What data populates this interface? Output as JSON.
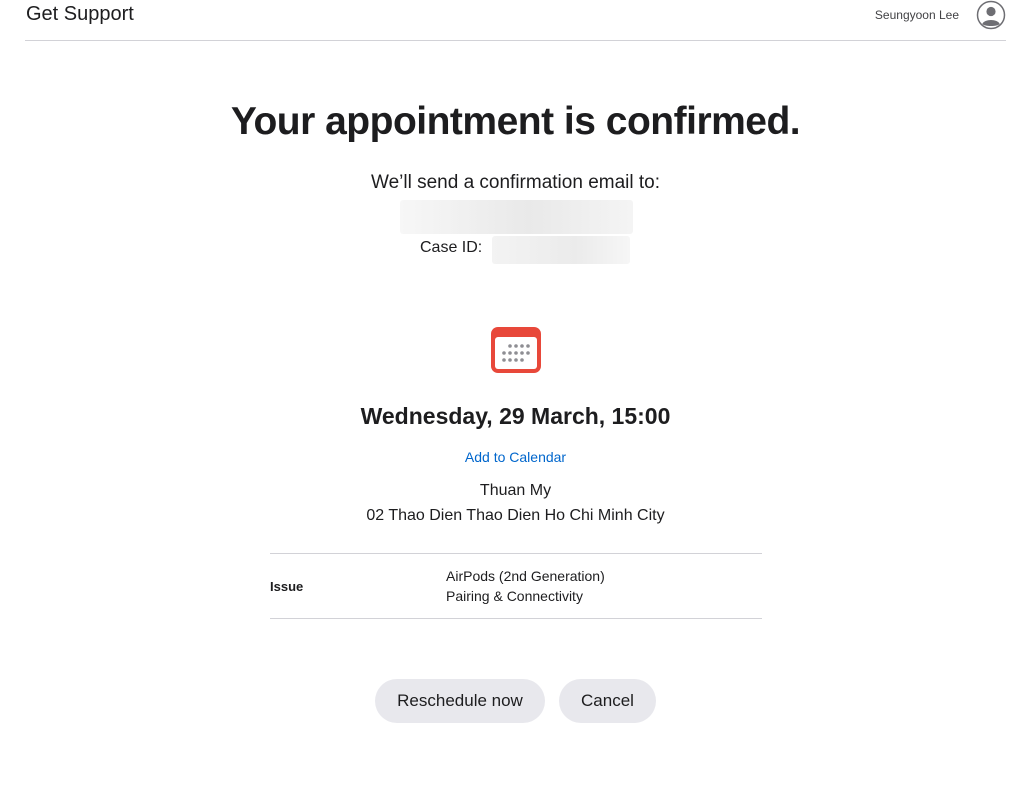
{
  "header": {
    "title": "Get Support",
    "user_name": "Seungyoon Lee",
    "avatar_icon": "user-circle-icon"
  },
  "confirmation": {
    "title": "Your appointment is confirmed.",
    "email_text": "We’ll send a confirmation email to:",
    "case_id_label": "Case ID:"
  },
  "appointment": {
    "calendar_icon": "calendar-icon",
    "date_time": "Wednesday, 29 March, 15:00",
    "add_to_calendar": "Add to Calendar",
    "store_name": "Thuan My",
    "store_address": "02 Thao Dien Thao Dien Ho Chi Minh City"
  },
  "issue": {
    "label": "Issue",
    "product": "AirPods (2nd Generation)",
    "topic": "Pairing & Connectivity"
  },
  "actions": {
    "reschedule": "Reschedule now",
    "cancel": "Cancel"
  },
  "colors": {
    "accent_link": "#0066cc",
    "calendar_red": "#e8483a",
    "button_bg": "#e8e8ed",
    "text": "#1d1d1f"
  }
}
